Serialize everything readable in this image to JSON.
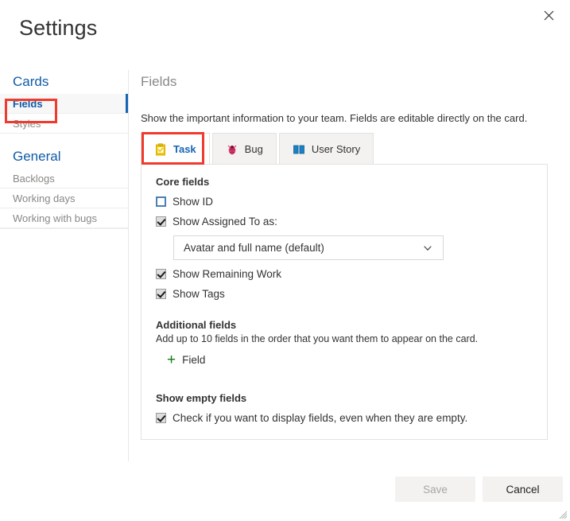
{
  "window": {
    "title": "Settings",
    "close_icon": "close-icon"
  },
  "sidebar": {
    "groups": [
      {
        "title": "Cards",
        "items": [
          {
            "label": "Fields",
            "selected": true
          },
          {
            "label": "Styles",
            "selected": false
          }
        ]
      },
      {
        "title": "General",
        "items": [
          {
            "label": "Backlogs",
            "selected": false
          },
          {
            "label": "Working days",
            "selected": false
          },
          {
            "label": "Working with bugs",
            "selected": false
          }
        ]
      }
    ]
  },
  "main": {
    "heading": "Fields",
    "description": "Show the important information to your team. Fields are editable directly on the card.",
    "tabs": [
      {
        "label": "Task",
        "icon": "clipboard-check-icon",
        "active": true
      },
      {
        "label": "Bug",
        "icon": "ladybug-icon",
        "active": false
      },
      {
        "label": "User Story",
        "icon": "open-book-icon",
        "active": false
      }
    ],
    "core_fields": {
      "label": "Core fields",
      "show_id": {
        "label": "Show ID",
        "checked": false
      },
      "show_assigned_to": {
        "label": "Show Assigned To as:",
        "checked": true
      },
      "assigned_to_value": "Avatar and full name (default)",
      "show_remaining_work": {
        "label": "Show Remaining Work",
        "checked": true
      },
      "show_tags": {
        "label": "Show Tags",
        "checked": true
      }
    },
    "additional_fields": {
      "label": "Additional fields",
      "description": "Add up to 10 fields in the order that you want them to appear on the card.",
      "add_label": "Field",
      "add_icon": "plus-icon"
    },
    "show_empty_fields": {
      "label": "Show empty fields",
      "checkbox_label": "Check if you want to display fields, even when they are empty.",
      "checked": true
    }
  },
  "footer": {
    "save_label": "Save",
    "save_enabled": false,
    "cancel_label": "Cancel"
  },
  "colors": {
    "accent_blue": "#1565b5",
    "link_blue": "#0f5ba8",
    "highlight_red": "#ef3b2d",
    "plus_green": "#107c10",
    "task_yellow": "#f2c811",
    "bug_red": "#d6336c"
  }
}
